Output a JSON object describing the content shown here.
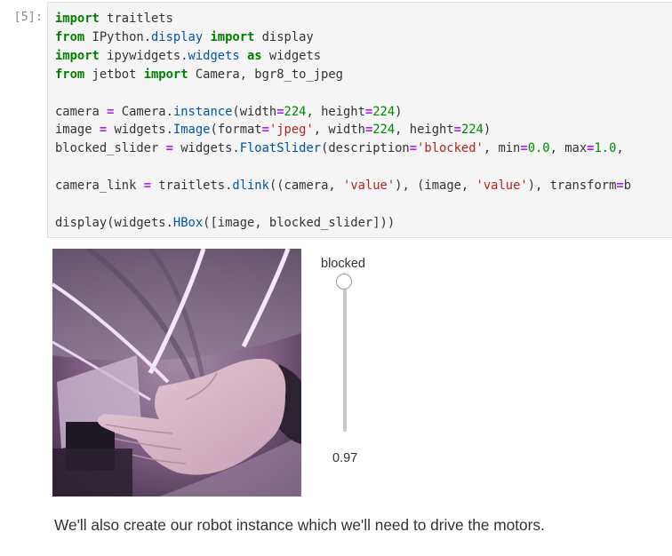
{
  "cell": {
    "prompt": "[5]:",
    "code_lines": [
      [
        {
          "cls": "kw",
          "text": "import"
        },
        {
          "cls": "",
          "text": " traitlets"
        }
      ],
      [
        {
          "cls": "kw",
          "text": "from"
        },
        {
          "cls": "",
          "text": " IPython"
        },
        {
          "cls": "",
          "text": "."
        },
        {
          "cls": "mod",
          "text": "display"
        },
        {
          "cls": "",
          "text": " "
        },
        {
          "cls": "kw",
          "text": "import"
        },
        {
          "cls": "",
          "text": " display"
        }
      ],
      [
        {
          "cls": "kw",
          "text": "import"
        },
        {
          "cls": "",
          "text": " ipywidgets"
        },
        {
          "cls": "",
          "text": "."
        },
        {
          "cls": "mod",
          "text": "widgets"
        },
        {
          "cls": "",
          "text": " "
        },
        {
          "cls": "kw",
          "text": "as"
        },
        {
          "cls": "",
          "text": " widgets"
        }
      ],
      [
        {
          "cls": "kw",
          "text": "from"
        },
        {
          "cls": "",
          "text": " jetbot "
        },
        {
          "cls": "kw",
          "text": "import"
        },
        {
          "cls": "",
          "text": " Camera, bgr8_to_jpeg"
        }
      ],
      [],
      [
        {
          "cls": "",
          "text": "camera "
        },
        {
          "cls": "op",
          "text": "="
        },
        {
          "cls": "",
          "text": " Camera"
        },
        {
          "cls": "",
          "text": "."
        },
        {
          "cls": "mod",
          "text": "instance"
        },
        {
          "cls": "",
          "text": "(width"
        },
        {
          "cls": "op",
          "text": "="
        },
        {
          "cls": "num",
          "text": "224"
        },
        {
          "cls": "",
          "text": ", height"
        },
        {
          "cls": "op",
          "text": "="
        },
        {
          "cls": "num",
          "text": "224"
        },
        {
          "cls": "",
          "text": ")"
        }
      ],
      [
        {
          "cls": "",
          "text": "image "
        },
        {
          "cls": "op",
          "text": "="
        },
        {
          "cls": "",
          "text": " widgets"
        },
        {
          "cls": "",
          "text": "."
        },
        {
          "cls": "mod",
          "text": "Image"
        },
        {
          "cls": "",
          "text": "(format"
        },
        {
          "cls": "op",
          "text": "="
        },
        {
          "cls": "str",
          "text": "'jpeg'"
        },
        {
          "cls": "",
          "text": ", width"
        },
        {
          "cls": "op",
          "text": "="
        },
        {
          "cls": "num",
          "text": "224"
        },
        {
          "cls": "",
          "text": ", height"
        },
        {
          "cls": "op",
          "text": "="
        },
        {
          "cls": "num",
          "text": "224"
        },
        {
          "cls": "",
          "text": ")"
        }
      ],
      [
        {
          "cls": "",
          "text": "blocked_slider "
        },
        {
          "cls": "op",
          "text": "="
        },
        {
          "cls": "",
          "text": " widgets"
        },
        {
          "cls": "",
          "text": "."
        },
        {
          "cls": "mod",
          "text": "FloatSlider"
        },
        {
          "cls": "",
          "text": "(description"
        },
        {
          "cls": "op",
          "text": "="
        },
        {
          "cls": "str",
          "text": "'blocked'"
        },
        {
          "cls": "",
          "text": ", min"
        },
        {
          "cls": "op",
          "text": "="
        },
        {
          "cls": "num",
          "text": "0.0"
        },
        {
          "cls": "",
          "text": ", max"
        },
        {
          "cls": "op",
          "text": "="
        },
        {
          "cls": "num",
          "text": "1.0"
        },
        {
          "cls": "",
          "text": ","
        }
      ],
      [],
      [
        {
          "cls": "",
          "text": "camera_link "
        },
        {
          "cls": "op",
          "text": "="
        },
        {
          "cls": "",
          "text": " traitlets"
        },
        {
          "cls": "",
          "text": "."
        },
        {
          "cls": "mod",
          "text": "dlink"
        },
        {
          "cls": "",
          "text": "((camera, "
        },
        {
          "cls": "str",
          "text": "'value'"
        },
        {
          "cls": "",
          "text": "), (image, "
        },
        {
          "cls": "str",
          "text": "'value'"
        },
        {
          "cls": "",
          "text": "), transform"
        },
        {
          "cls": "op",
          "text": "="
        },
        {
          "cls": "",
          "text": "b"
        }
      ],
      [],
      [
        {
          "cls": "",
          "text": "display(widgets"
        },
        {
          "cls": "",
          "text": "."
        },
        {
          "cls": "mod",
          "text": "HBox"
        },
        {
          "cls": "",
          "text": "([image, blocked_slider]))"
        }
      ]
    ]
  },
  "output": {
    "camera_frame_icon": "camera-frame-image",
    "slider": {
      "label": "blocked",
      "value_text": "0.97",
      "value": 0.97,
      "min": 0.0,
      "max": 1.0,
      "orientation": "vertical"
    }
  },
  "markdown": {
    "text": "We'll also create our robot instance which we'll need to drive the motors."
  }
}
